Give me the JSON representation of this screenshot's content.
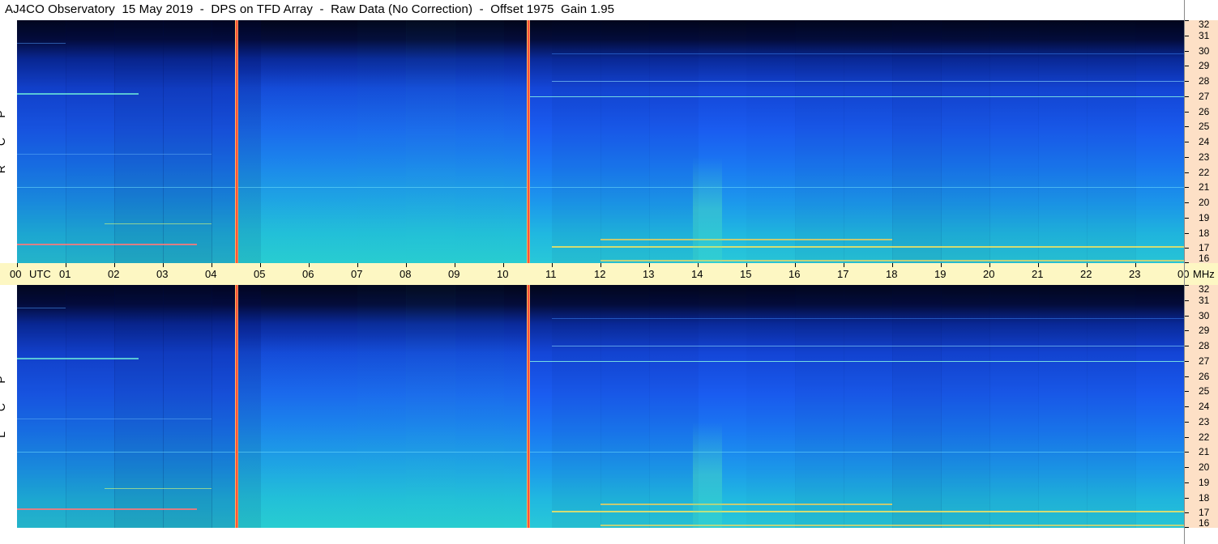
{
  "title": "AJ4CO Observatory  15 May 2019  -  DPS on TFD Array  -  Raw Data (No Correction)  -  Offset 1975  Gain 1.95",
  "panels": [
    {
      "id": "top",
      "polarization": [
        "R",
        "C",
        "P"
      ]
    },
    {
      "id": "bottom",
      "polarization": [
        "L",
        "C",
        "P"
      ]
    }
  ],
  "time_axis": {
    "labels": [
      "00",
      "UTC",
      "01",
      "02",
      "03",
      "04",
      "05",
      "06",
      "07",
      "08",
      "09",
      "10",
      "11",
      "12",
      "13",
      "14",
      "15",
      "16",
      "17",
      "18",
      "19",
      "20",
      "21",
      "22",
      "23",
      "00",
      "MHz"
    ]
  },
  "chart_data": {
    "type": "heatmap",
    "title": "AJ4CO Observatory  15 May 2019  -  DPS on TFD Array  -  Raw Data (No Correction)  -  Offset 1975  Gain 1.95",
    "x_unit": "UTC",
    "y_unit": "MHz",
    "xlim": [
      0,
      24
    ],
    "ylim": [
      16,
      32
    ],
    "x_ticks": [
      "00",
      "01",
      "02",
      "03",
      "04",
      "05",
      "06",
      "07",
      "08",
      "09",
      "10",
      "11",
      "12",
      "13",
      "14",
      "15",
      "16",
      "17",
      "18",
      "19",
      "20",
      "21",
      "22",
      "23",
      "00"
    ],
    "y_ticks": [
      32,
      31,
      30,
      29,
      28,
      27,
      26,
      25,
      24,
      23,
      22,
      21,
      20,
      19,
      18,
      17,
      16
    ],
    "series": [
      {
        "polarization": "RCP"
      },
      {
        "polarization": "LCP"
      }
    ],
    "interference_lines_utc": [
      4.5,
      10.5
    ],
    "colors": {
      "low": "#0a0a28",
      "mid": "#1a55ff",
      "high": "#20d0d0",
      "peak": "#ff4040",
      "timebar": "#fdf7c3",
      "freqbar": "#fde0c6"
    }
  }
}
